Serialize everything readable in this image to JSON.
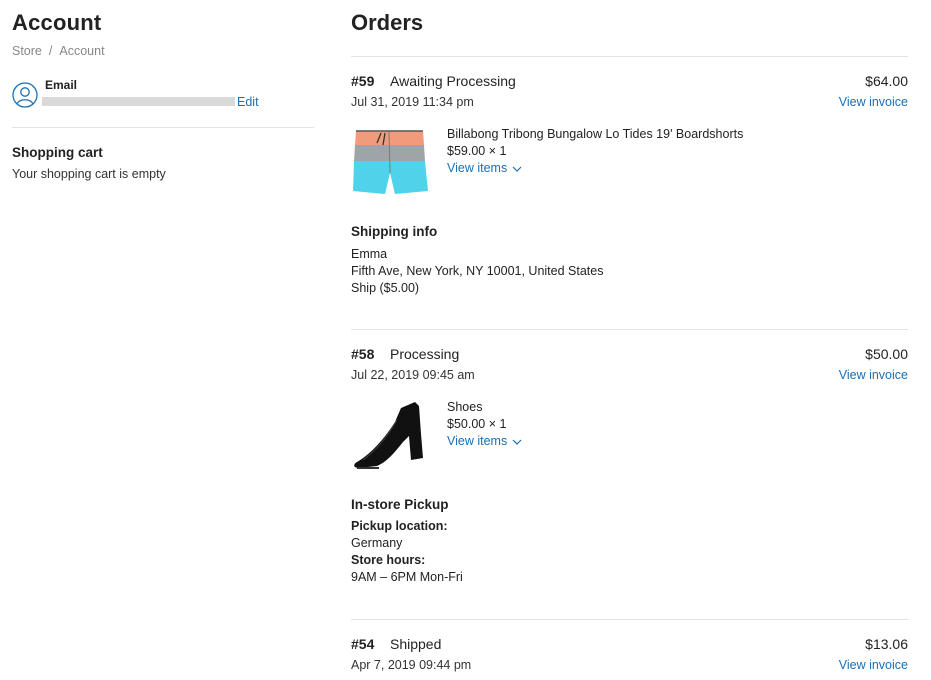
{
  "account": {
    "title": "Account",
    "breadcrumb": [
      "Store",
      "Account"
    ],
    "breadcrumb_sep": "/",
    "email_label": "Email",
    "edit_label": "Edit"
  },
  "cart": {
    "title": "Shopping cart",
    "empty_text": "Your shopping cart is empty"
  },
  "orders_title": "Orders",
  "orders": [
    {
      "number": "#59",
      "status": "Awaiting Processing",
      "total": "$64.00",
      "date": "Jul 31, 2019 11:34 pm",
      "invoice_label": "View invoice",
      "item_name": "Billabong Tribong Bungalow Lo Tides 19' Boardshorts",
      "item_qty": "$59.00 × 1",
      "view_items": "View items",
      "thumb_icon": "boardshorts-image",
      "info_title": "Shipping info",
      "info_lines": [
        {
          "text": "Emma",
          "bold": false
        },
        {
          "text": "Fifth Ave, New York, NY 10001, United States",
          "bold": false
        },
        {
          "text": "Ship ($5.00)",
          "bold": false
        }
      ]
    },
    {
      "number": "#58",
      "status": "Processing",
      "total": "$50.00",
      "date": "Jul 22, 2019 09:45 am",
      "invoice_label": "View invoice",
      "item_name": "Shoes",
      "item_qty": "$50.00 × 1",
      "view_items": "View items",
      "thumb_icon": "shoe-image",
      "info_title": "In-store Pickup",
      "info_lines": [
        {
          "text": "Pickup location:",
          "bold": true
        },
        {
          "text": "Germany",
          "bold": false
        },
        {
          "text": "Store hours:",
          "bold": true
        },
        {
          "text": "9AM – 6PM Mon-Fri",
          "bold": false
        }
      ]
    },
    {
      "number": "#54",
      "status": "Shipped",
      "total": "$13.06",
      "date": "Apr 7, 2019 09:44 pm",
      "invoice_label": "View invoice"
    }
  ],
  "colors": {
    "link": "#1a6fb5",
    "divider": "#e3e3e3",
    "text": "#222222"
  }
}
